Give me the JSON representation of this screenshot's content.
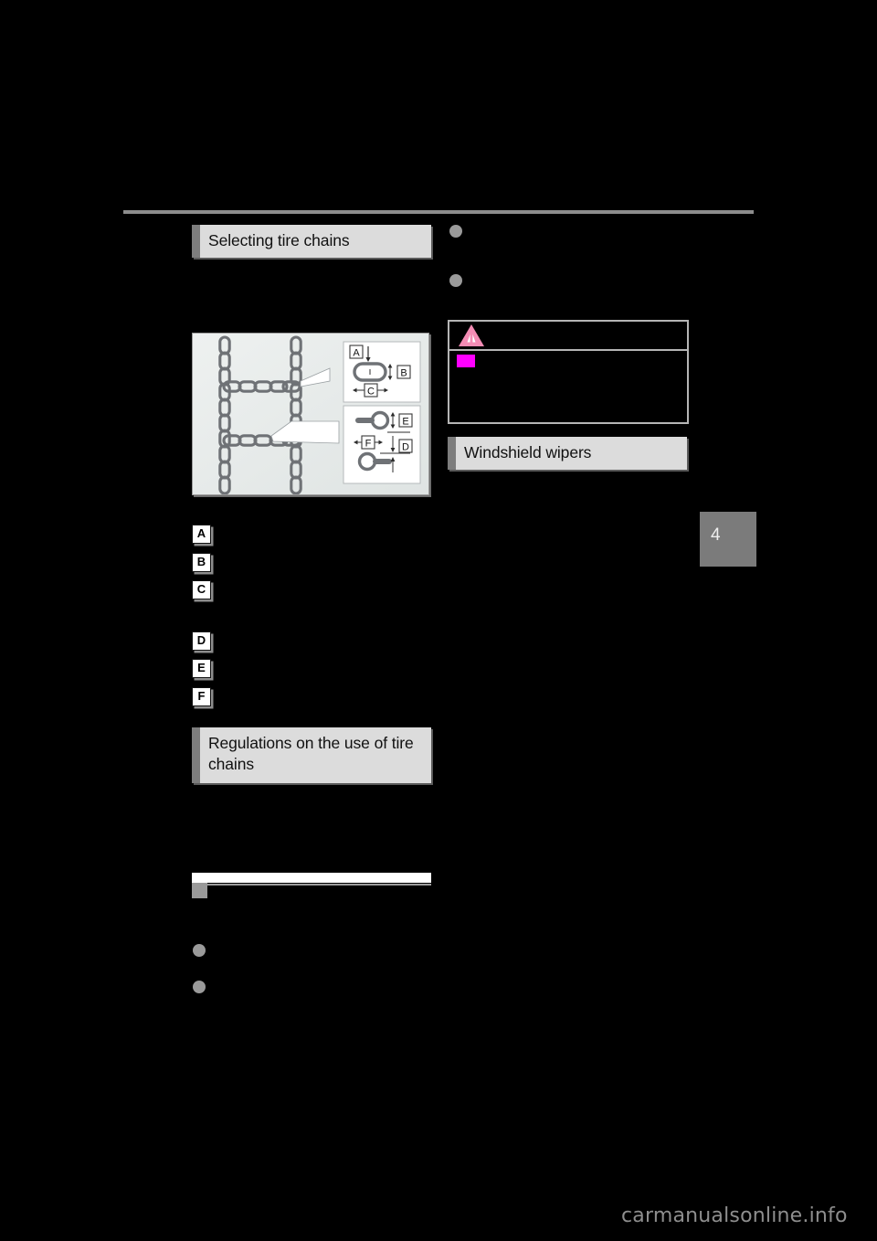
{
  "page": {
    "background_color": "#000000",
    "chapter_tab": {
      "number": "4",
      "color": "#7b7b7b"
    },
    "watermark": "carmanualsonline.info",
    "rule_color": "#8c8c8c"
  },
  "left_column": {
    "headings": [
      {
        "id": "selecting-tire-chains",
        "text": "Selecting tire chains"
      },
      {
        "id": "regulations-tire-chains",
        "text": "Regulations on the use of tire chains"
      }
    ],
    "figure": {
      "name": "tire-chain-dimensions-diagram",
      "background_color": "#e9edec",
      "callout_labels": [
        "A",
        "B",
        "C",
        "E",
        "F",
        "D"
      ]
    },
    "markers": [
      {
        "letter": "A"
      },
      {
        "letter": "B"
      },
      {
        "letter": "C"
      },
      {
        "letter": "D"
      },
      {
        "letter": "E"
      },
      {
        "letter": "F"
      }
    ],
    "subsection_divider": {
      "ghost_text": ""
    },
    "bullets": [
      {
        "type": "dot"
      },
      {
        "type": "dot"
      }
    ]
  },
  "right_column": {
    "bullets": [
      {
        "type": "dot"
      },
      {
        "type": "dot"
      }
    ],
    "warning_box": {
      "icon": "warning-triangle-icon",
      "icon_color": "#f48cb4",
      "bullet_color": "#ff00ff",
      "border_color": "#b5b5b5"
    },
    "headings": [
      {
        "id": "windshield-wipers",
        "text": "Windshield wipers"
      }
    ]
  },
  "theme": {
    "heading_bg": "#dcdcdc",
    "heading_accent": "#7d7d7d",
    "bullet_gray": "#9a9a9a",
    "marker_shadow": "#8d8d8d"
  }
}
